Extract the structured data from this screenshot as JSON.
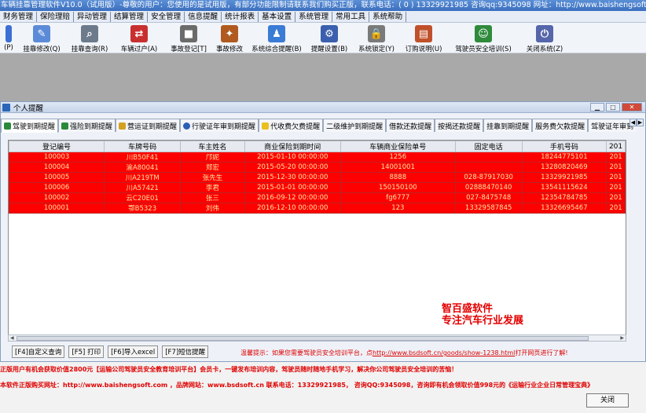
{
  "window": {
    "title_prefix": "车辆挂靠管理软件V10.0（试用版）",
    "title_rest": "-尊敬的用户：您使用的是试用版，有部分功能限制请联系我们购买正版，联系电话：( 0 ) 13329921985 咨询qq:9345098   网址：http://www.baishengsoft.com"
  },
  "menu": [
    "财务管理",
    "保险理赔",
    "异动管理",
    "结算管理",
    "安全管理",
    "信息提醒",
    "统计报表",
    "基本设置",
    "系统管理",
    "常用工具",
    "系统帮助"
  ],
  "toolbar": [
    {
      "label": "(P)",
      "icon": "car-icon",
      "color": "#3b6fd4"
    },
    {
      "label": "挂靠修改(Q)",
      "icon": "edit-document-icon",
      "color": "#5b8bd8"
    },
    {
      "label": "挂靠查询(R)",
      "icon": "search-car-icon",
      "color": "#6c7a8c"
    },
    {
      "label": "车辆过户(A)",
      "icon": "transfer-icon",
      "color": "#c83030"
    },
    {
      "label": "事故登记[T]",
      "icon": "cube-icon",
      "color": "#6b6b6b"
    },
    {
      "label": "事故修改",
      "icon": "wrench-icon",
      "color": "#b05a20"
    },
    {
      "label": "系统综合提醒(B)",
      "icon": "reminder-icon",
      "color": "#3a7bd5"
    },
    {
      "label": "提醒设置(B)",
      "icon": "gear-icon",
      "color": "#3a5fae"
    },
    {
      "label": "系统锁定(Y)",
      "icon": "lock-icon",
      "color": "#7a7a7a"
    },
    {
      "label": "订购说明(U)",
      "icon": "book-icon",
      "color": "#c0502a"
    },
    {
      "label": "驾驶员安全培训(S)",
      "icon": "team-icon",
      "color": "#2f8a3c"
    },
    {
      "label": "关闭系统(Z)",
      "icon": "power-icon",
      "color": "#5566aa"
    }
  ],
  "child": {
    "title": "个人提醒",
    "min": "▁",
    "max": "□",
    "close": "✕"
  },
  "tabs": [
    "驾驶到期提醒",
    "强险到期提醒",
    "营运证到期提醒",
    "行驶证年审到期提醒",
    "代收费欠费提醒",
    "二级维护到期提醒",
    "借款还款提醒",
    "按揭还款提醒",
    "挂靠到期提醒",
    "服务费欠款提醒",
    "驾驶证年审到"
  ],
  "table": {
    "columns": [
      "登记编号",
      "车牌号码",
      "车主姓名",
      "商业保险到期时间",
      "车辆商业保险单号",
      "固定电话",
      "手机号码",
      "201"
    ],
    "rows": [
      [
        "100003",
        "川B50F41",
        "邝妮",
        "2015-01-10 00:00:00",
        "1256",
        "",
        "18244775101",
        "201"
      ],
      [
        "100004",
        "渝A80041",
        "郑宏",
        "2015-05-20 00:00:00",
        "14001001",
        "",
        "13280820469",
        "201"
      ],
      [
        "100005",
        "川A219TM",
        "张先生",
        "2015-12-30 00:00:00",
        "8888",
        "028-87917030",
        "13329921985",
        "201"
      ],
      [
        "100006",
        "川A57421",
        "李君",
        "2015-01-01 00:00:00",
        "150150100",
        "02888470140",
        "13541115624",
        "201"
      ],
      [
        "100002",
        "云C20E01",
        "张三",
        "2016-09-12 00:00:00",
        "fg6777",
        "027-8475748",
        "12354784785",
        "201"
      ],
      [
        "100001",
        "鄂B5323",
        "刘伟",
        "2016-12-10 00:00:00",
        "123",
        "13329587845",
        "13326695467",
        "201"
      ]
    ]
  },
  "brand": {
    "line1": "智百盛软件",
    "line2": "专注汽车行业发展"
  },
  "buttons": [
    "[F4]自定义查询",
    "[F5] 打印",
    "[F6]导入excel",
    "[F7]短信提醒"
  ],
  "tip": {
    "prefix": "温馨提示：如果您需要驾驶员安全培训平台，点",
    "link": "http://www.bsdsoft.cn/goods/show-1238.html",
    "suffix": "打开网页进行了解!"
  },
  "footer": {
    "line1": "正版用户有机会获取价值2800元【运输公司驾驶员安全教育培训平台】会员卡，一键发布培训内容，驾驶员随时随地手机学习，解决你公司驾驶员安全培训的苦恼！",
    "line2": "本软件正版购买网址：http://www.baishengsoft.com ，品牌网站：www.bsdsoft.cn  联系电话：13329921985，  咨询QQ:9345098，咨询即有机会领取价值998元的《运输行业企业日常管理宝典》",
    "close_label": "关闭"
  }
}
